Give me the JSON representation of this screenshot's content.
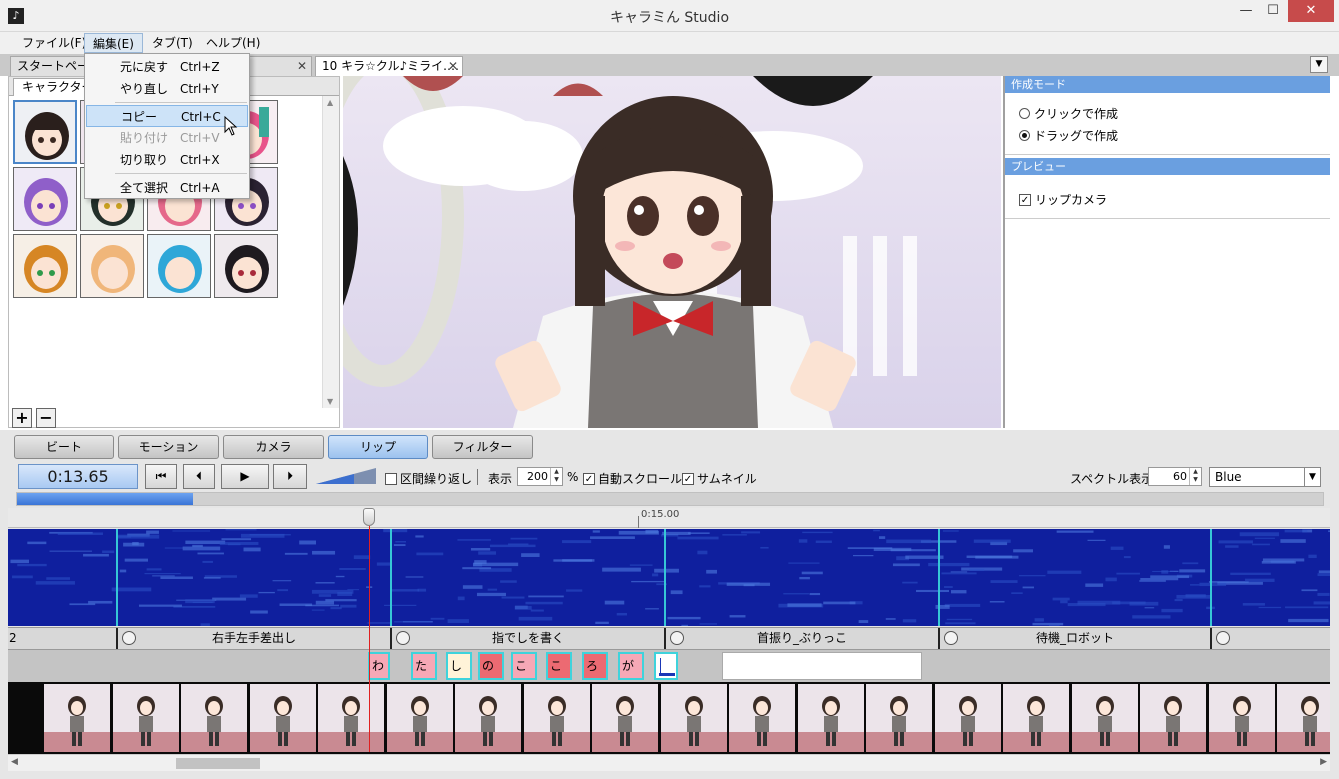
{
  "window": {
    "title": "キャラミん Studio",
    "app_icon": "music-note-icon",
    "minimize": "—",
    "maximize": "☐",
    "close": "✕"
  },
  "menubar": {
    "file": "ファイル(F)",
    "edit": "編集(E)",
    "tab": "タブ(T)",
    "help": "ヘルプ(H)"
  },
  "edit_menu": {
    "undo": {
      "label": "元に戻す",
      "shortcut": "Ctrl+Z"
    },
    "redo": {
      "label": "やり直し",
      "shortcut": "Ctrl+Y"
    },
    "copy": {
      "label": "コピー",
      "shortcut": "Ctrl+C"
    },
    "paste": {
      "label": "貼り付け",
      "shortcut": "Ctrl+V"
    },
    "cut": {
      "label": "切り取り",
      "shortcut": "Ctrl+X"
    },
    "select_all": {
      "label": "全て選択",
      "shortcut": "Ctrl+A"
    }
  },
  "tabs": {
    "start_page": "スタートページ",
    "song": "10 キラ☆クル♪ミライ.…",
    "close": "✕"
  },
  "left_panel": {
    "tab": "キャラクター",
    "add": "+",
    "remove": "−"
  },
  "right_panel": {
    "mode_header": "作成モード",
    "click_mode": "クリックで作成",
    "drag_mode": "ドラッグで作成",
    "preview_header": "プレビュー",
    "lip_camera": "リップカメラ"
  },
  "panel_tabs": {
    "beat": "ビート",
    "motion": "モーション",
    "camera": "カメラ",
    "lip": "リップ",
    "filter": "フィルター"
  },
  "transport": {
    "time": "0:13.65",
    "rewind": "⏮",
    "prev": "⏴",
    "play": "▶",
    "next": "⏵",
    "section_loop": "区間繰り返し",
    "display_label": "表示",
    "zoom": "200",
    "zoom_unit": "%",
    "auto_scroll": "自動スクロール",
    "thumbnail": "サムネイル",
    "spectrum_label": "スペクトル表示",
    "spectrum_value": "60",
    "color_scheme": "Blue",
    "progress": 0.135
  },
  "timeline": {
    "ruler_label": "0:15.00",
    "motions": [
      "2",
      "右手左手差出し",
      "指でしを書く",
      "首振り_ぶりっこ",
      "待機_ロボット"
    ],
    "lip_syllables": [
      "わ",
      "た",
      "し",
      "の",
      "こ",
      "こ",
      "ろ",
      "が"
    ]
  }
}
